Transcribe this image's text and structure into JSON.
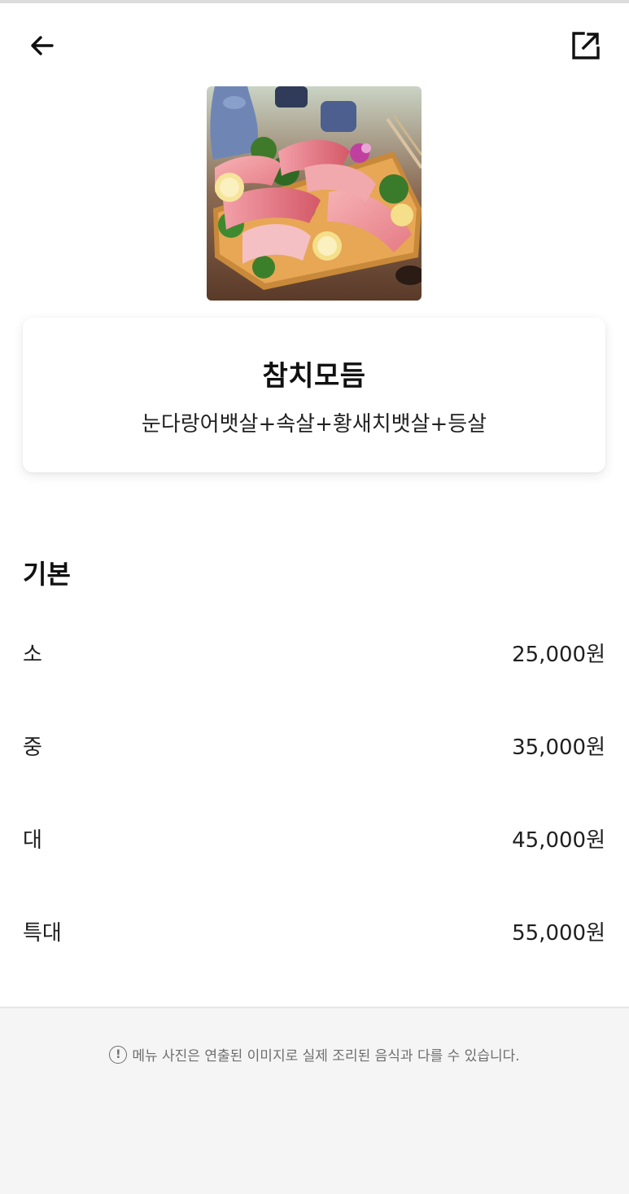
{
  "menu": {
    "name": "참치모듬",
    "description": "눈다랑어뱃살+속살+황새치뱃살+등살",
    "photo_alt": "참치모듬 사진"
  },
  "section": {
    "title": "기본"
  },
  "prices": [
    {
      "label": "소",
      "price": "25,000원"
    },
    {
      "label": "중",
      "price": "35,000원"
    },
    {
      "label": "대",
      "price": "45,000원"
    },
    {
      "label": "특대",
      "price": "55,000원"
    }
  ],
  "footer": {
    "notice_icon": "!",
    "notice": "메뉴 사진은 연출된 이미지로 실제 조리된 음식과 다를 수 있습니다."
  },
  "icons": {
    "back": "arrow-left-icon",
    "share": "share-external-icon",
    "notice": "exclamation-circle-icon"
  },
  "colors": {
    "background": "#ffffff",
    "footer_background": "#f5f5f5",
    "text_primary": "#111111",
    "text_muted": "#6e6e6e"
  }
}
